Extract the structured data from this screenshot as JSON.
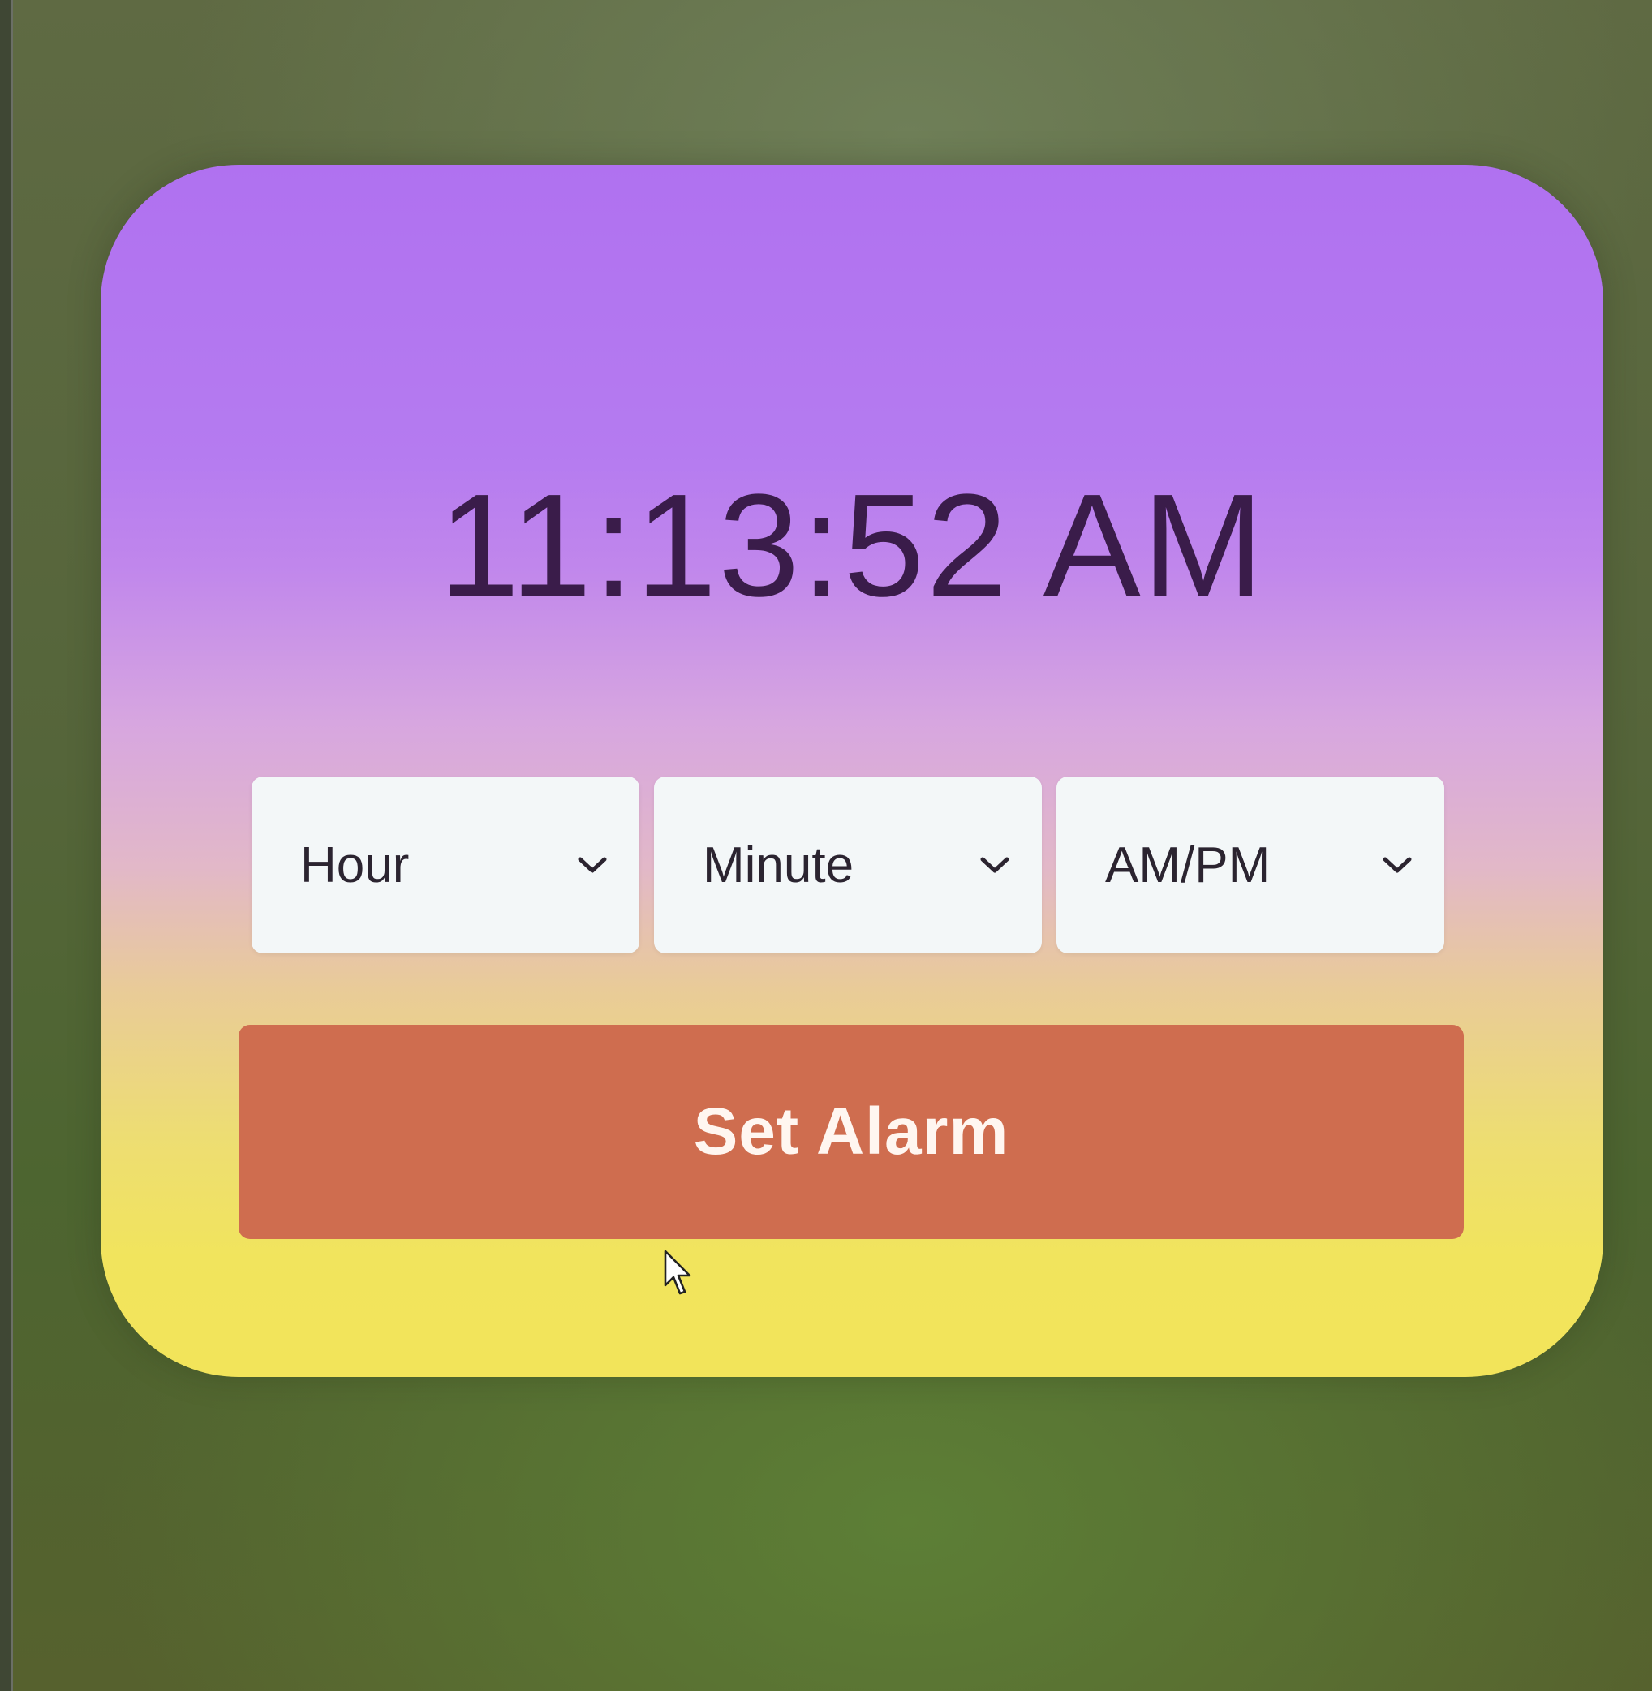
{
  "clock": {
    "time": "11:13:52 AM"
  },
  "alarm_form": {
    "hour_select": {
      "selected": "Hour"
    },
    "minute_select": {
      "selected": "Minute"
    },
    "ampm_select": {
      "selected": "AM/PM"
    },
    "set_button_label": "Set Alarm"
  },
  "icons": {
    "dropdown": "chevron-down-icon",
    "pointer": "mouse-cursor-icon"
  },
  "colors": {
    "card_gradient_top": "#b071f0",
    "card_gradient_bottom": "#f2e45a",
    "button": "#cf6d4f",
    "clock_text": "#3a1c4a",
    "select_bg": "#f3f7f8"
  }
}
